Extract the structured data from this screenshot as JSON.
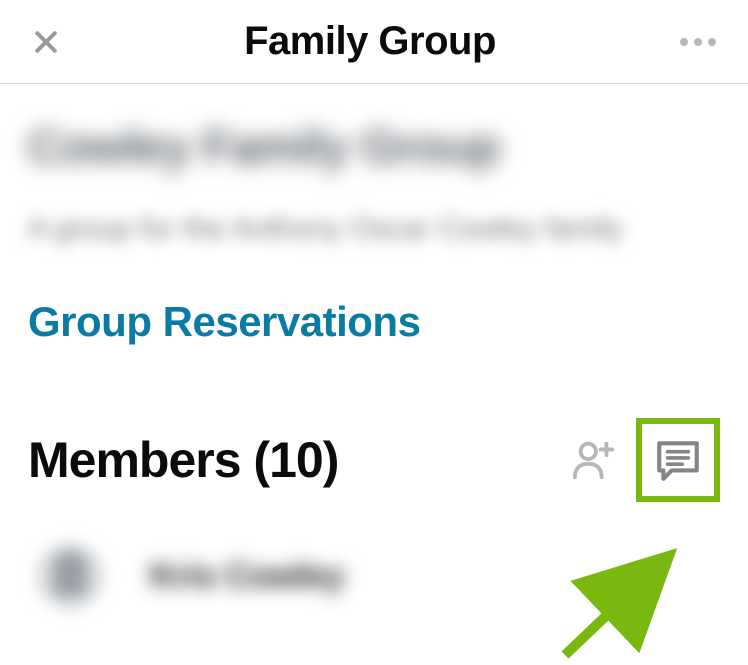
{
  "header": {
    "title": "Family Group"
  },
  "group": {
    "name": "Cowley Family Group",
    "description": "A group for the Anthony Oscar Cowley family"
  },
  "links": {
    "reservations": "Group Reservations"
  },
  "members": {
    "heading": "Members (10)",
    "count": 10,
    "items": [
      {
        "name": "Kris Cowley"
      }
    ]
  },
  "colors": {
    "highlight": "#78b80f",
    "link": "#0a7ba4"
  }
}
